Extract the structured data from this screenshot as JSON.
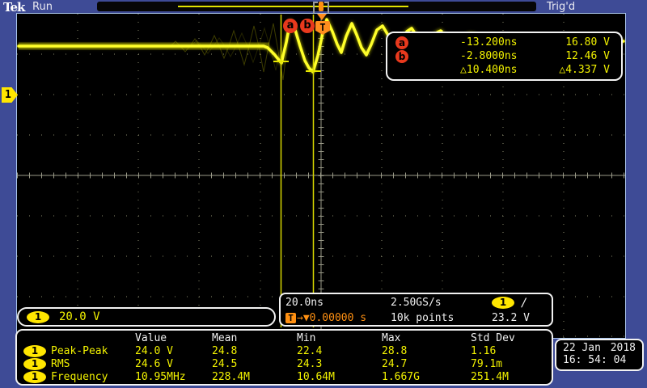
{
  "header": {
    "brand": "Tek",
    "acq_status": "Run",
    "trig_status": "Trig'd"
  },
  "channel": {
    "badge": "1",
    "scale": "20.0 V"
  },
  "cursors": {
    "a_label": "a",
    "a_time": "-13.200ns",
    "a_volt": "16.80 V",
    "b_label": "b",
    "b_time": "-2.8000ns",
    "b_volt": "12.46 V",
    "delta_time": "△10.400ns",
    "delta_volt": "△4.337 V"
  },
  "trigger": {
    "t_label": "T",
    "t_badge": "T",
    "arrow_glyph": "→",
    "level_marker_glyph": "▼",
    "position": "0.00000 s",
    "source_badge": "1",
    "slope_glyph": "/",
    "level": "23.2 V"
  },
  "horizontal": {
    "scale": "20.0ns",
    "sample_rate": "2.50GS/s",
    "record_length": "10k points"
  },
  "measurements": {
    "headers": {
      "value": "Value",
      "mean": "Mean",
      "min": "Min",
      "max": "Max",
      "std": "Std Dev"
    },
    "rows": [
      {
        "badge": "1",
        "name": "Peak-Peak",
        "value": "24.0 V",
        "mean": "24.8",
        "min": "22.4",
        "max": "28.8",
        "std": "1.16"
      },
      {
        "badge": "1",
        "name": "RMS",
        "value": "24.6 V",
        "mean": "24.5",
        "min": "24.3",
        "max": "24.7",
        "std": "79.1m"
      },
      {
        "badge": "1",
        "name": "Frequency",
        "value": "10.95MHz",
        "mean": "228.4M",
        "min": "10.64M",
        "max": "1.667G",
        "std": "251.4M"
      }
    ]
  },
  "datetime": {
    "date": "22 Jan",
    "year": "2018",
    "time": "16: 54: 04"
  },
  "colors": {
    "channel1": "#f2f200",
    "trigger_orange": "#ff9012",
    "cursor_badge_red": "#e8391d",
    "chrome_blue": "#3e4b96"
  }
}
